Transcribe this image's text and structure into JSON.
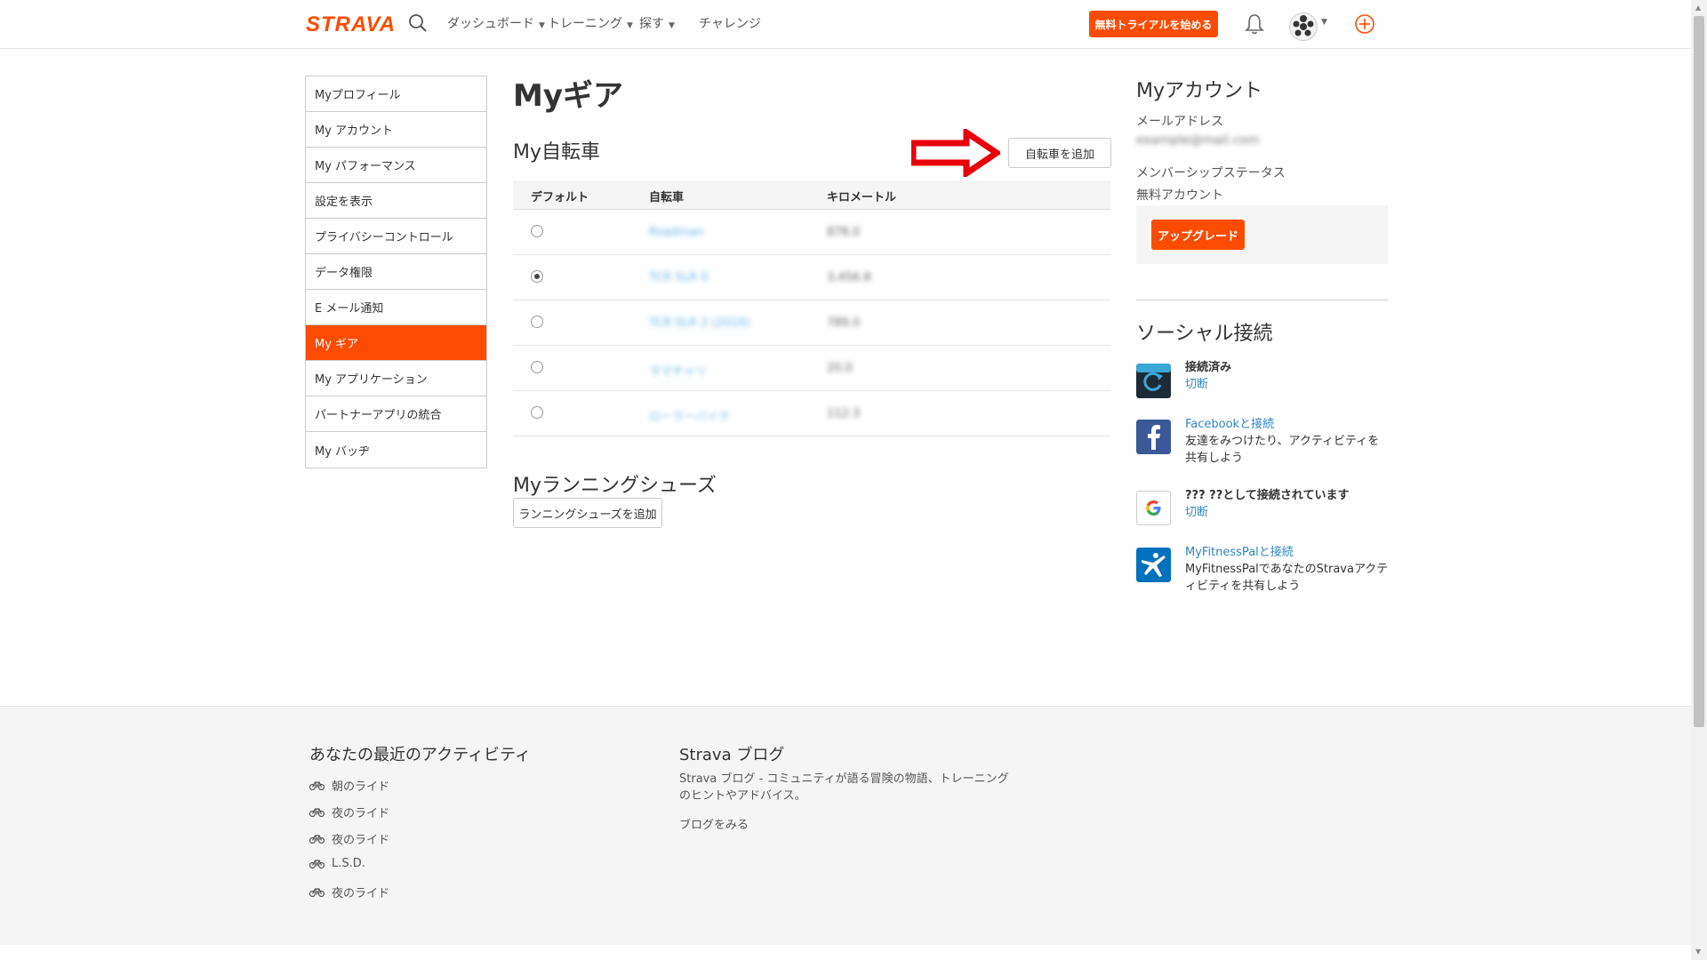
{
  "header": {
    "logo": "STRAVA",
    "nav": [
      "ダッシュボード",
      "トレーニング",
      "探す",
      "チャレンジ"
    ],
    "trial_button": "無料トライアルを始める"
  },
  "sidebar": {
    "items": [
      {
        "label": "Myプロフィール",
        "active": false
      },
      {
        "label": "My アカウント",
        "active": false
      },
      {
        "label": "My パフォーマンス",
        "active": false
      },
      {
        "label": "設定を表示",
        "active": false
      },
      {
        "label": "プライバシーコントロール",
        "active": false
      },
      {
        "label": "データ権限",
        "active": false
      },
      {
        "label": "E メール通知",
        "active": false
      },
      {
        "label": "My ギア",
        "active": true
      },
      {
        "label": "My アプリケーション",
        "active": false
      },
      {
        "label": "パートナーアプリの統合",
        "active": false
      },
      {
        "label": "My バッヂ",
        "active": false
      }
    ]
  },
  "main": {
    "title": "Myギア",
    "bikes_title": "My自転車",
    "add_bike_button": "自転車を追加",
    "columns": [
      "デフォルト",
      "自転車",
      "キロメートル"
    ],
    "bikes": [
      {
        "name": "Roadman",
        "km": "878.0",
        "default": false
      },
      {
        "name": "TCR SLR 0",
        "km": "3,456.8",
        "default": true
      },
      {
        "name": "TCR SLR 2 (2016)",
        "km": "789.0",
        "default": false
      },
      {
        "name": "ママチャリ",
        "km": "20.0",
        "default": false
      },
      {
        "name": "ローラーバイク",
        "km": "112.3",
        "default": false
      }
    ],
    "shoes_title": "Myランニングシューズ",
    "add_shoes_button": "ランニングシューズを追加"
  },
  "account": {
    "title": "Myアカウント",
    "email_label": "メールアドレス",
    "email_value": "example@mail.com",
    "membership_label": "メンバーシップステータス",
    "membership_value": "無料アカウント",
    "upgrade_button": "アップグレード"
  },
  "social": {
    "title": "ソーシャル接続",
    "items": [
      {
        "title": "接続済み",
        "sub": "切断"
      },
      {
        "title": "Facebookと接続",
        "sub": "友達をみつけたり、アクティビティを共有しよう"
      },
      {
        "title": "??? ??として接続されています",
        "sub": "切断"
      },
      {
        "title": "MyFitnessPalと接続",
        "sub": "MyFitnessPalであなたのStravaアクティビティを共有しよう"
      }
    ]
  },
  "footer": {
    "recent_title": "あなたの最近のアクティビティ",
    "recent": [
      "朝のライド",
      "夜のライド",
      "夜のライド",
      "L.S.D.",
      "夜のライド"
    ],
    "blog_title": "Strava ブログ",
    "blog_desc": "Strava ブログ - コミュニティが語る冒険の物語、トレーニングのヒントやアドバイス。",
    "blog_link": "ブログをみる"
  },
  "colors": {
    "accent": "#fc4c02",
    "link": "#2f85c5",
    "arrow": "#e8000b"
  }
}
